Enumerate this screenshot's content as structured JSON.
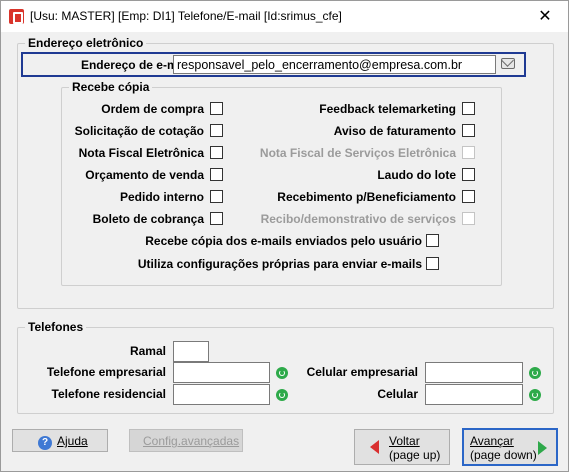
{
  "window": {
    "title": "[Usu: MASTER] [Emp: DI1] Telefone/E-mail [Id:srimus_cfe]",
    "close_glyph": "✕"
  },
  "email_section": {
    "title": "Endereço eletrônico",
    "email_label": "Endereço de e-mail",
    "email_value": "responsavel_pelo_encerramento@empresa.com.br",
    "mail_icon": "envelope-icon"
  },
  "copy_section": {
    "title": "Recebe cópia",
    "left_items": [
      {
        "label": "Ordem de compra",
        "checked": false,
        "enabled": true
      },
      {
        "label": "Solicitação de cotação",
        "checked": false,
        "enabled": true
      },
      {
        "label": "Nota Fiscal Eletrônica",
        "checked": false,
        "enabled": true
      },
      {
        "label": "Orçamento de venda",
        "checked": false,
        "enabled": true
      },
      {
        "label": "Pedido interno",
        "checked": false,
        "enabled": true
      },
      {
        "label": "Boleto de cobrança",
        "checked": false,
        "enabled": true
      }
    ],
    "right_items": [
      {
        "label": "Feedback telemarketing",
        "checked": false,
        "enabled": true
      },
      {
        "label": "Aviso de faturamento",
        "checked": false,
        "enabled": true
      },
      {
        "label": "Nota Fiscal de Serviços Eletrônica",
        "checked": false,
        "enabled": false
      },
      {
        "label": "Laudo do lote",
        "checked": false,
        "enabled": true
      },
      {
        "label": "Recebimento p/Beneficiamento",
        "checked": false,
        "enabled": true
      },
      {
        "label": "Recibo/demonstrativo de serviços",
        "checked": false,
        "enabled": false
      }
    ],
    "wide_items": [
      {
        "label": "Recebe cópia dos e-mails enviados pelo usuário",
        "checked": false
      },
      {
        "label": "Utiliza configurações próprias para enviar e-mails",
        "checked": false
      }
    ]
  },
  "phones_section": {
    "title": "Telefones",
    "ramal_label": "Ramal",
    "ramal_value": "",
    "tel_empresarial_label": "Telefone empresarial",
    "tel_empresarial_value": "",
    "tel_residencial_label": "Telefone residencial",
    "tel_residencial_value": "",
    "cel_empresarial_label": "Celular empresarial",
    "cel_empresarial_value": "",
    "celular_label": "Celular",
    "celular_value": "",
    "whatsapp_icon": "whatsapp-icon"
  },
  "footer": {
    "help_label": "Ajuda",
    "config_label": "Config.avançadas",
    "back_label_1": "Voltar",
    "back_label_2": "(page up)",
    "next_label_1": "Avançar",
    "next_label_2": "(page down)"
  }
}
